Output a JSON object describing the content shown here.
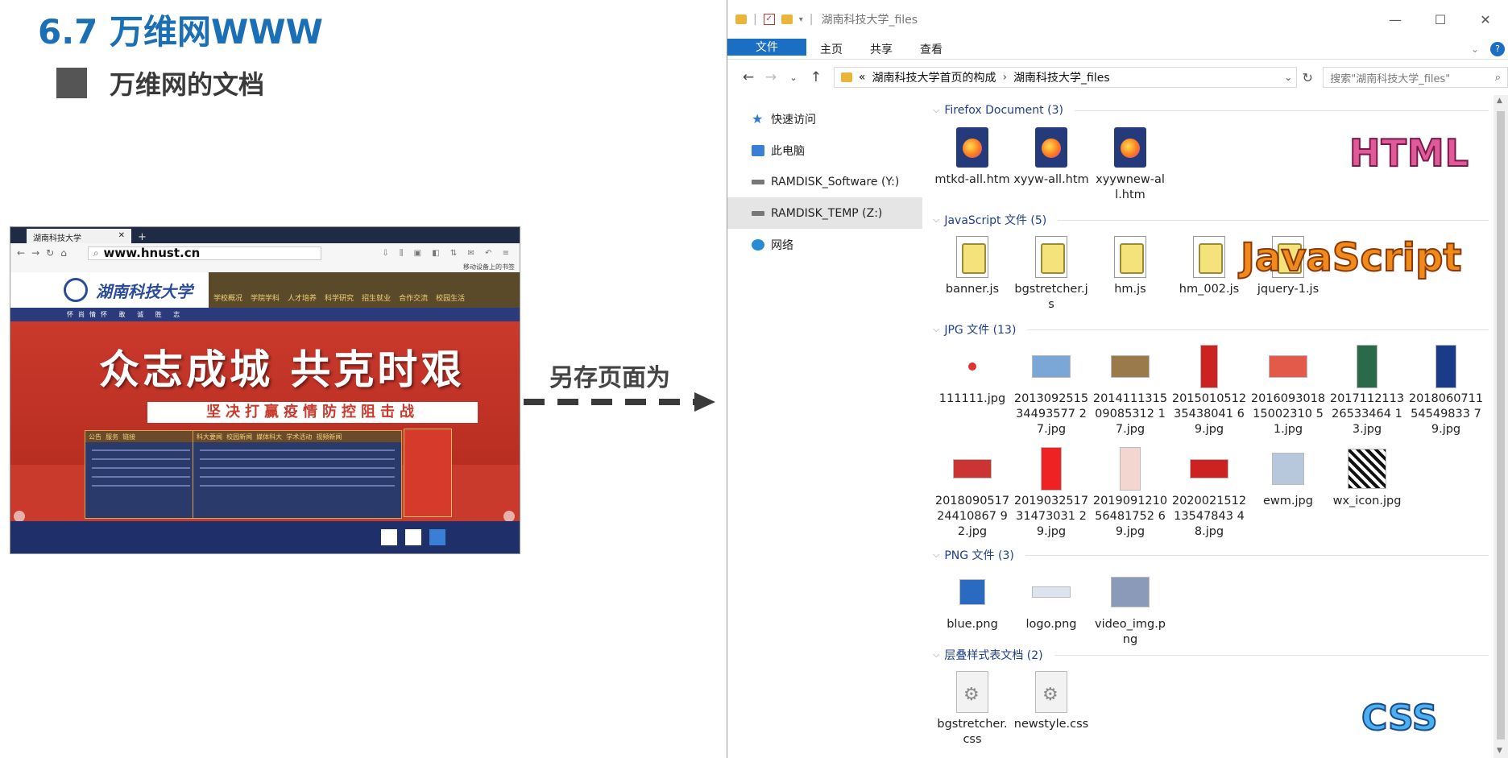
{
  "slide": {
    "title": "6.7 万维网WWW",
    "subtitle": "万维网的文档"
  },
  "browser": {
    "tab_title": "湖南科技大学",
    "url": "www.hnust.cn",
    "bookmark_hint": "移动设备上的书签",
    "logo_text": "湖南科技大学",
    "nav_items": [
      "学校概况",
      "学院学科",
      "人才培养",
      "科学研究",
      "招生就业",
      "合作交流",
      "校园生活"
    ],
    "motto": "怀尚情怀 敢 诚 胜 志",
    "banner_title": "众志成城 共克时艰",
    "banner_subtitle": "坚决打赢疫情防控阻击战",
    "panel_a_tabs": [
      "公告",
      "服务",
      "链接"
    ],
    "panel_b_tabs": [
      "科大要闻",
      "校园新闻",
      "媒体科大",
      "学术活动",
      "视频新闻"
    ]
  },
  "saveas_label": "另存页面为",
  "explorer": {
    "title": "湖南科技大学_files",
    "ribbon_tabs": [
      "文件",
      "主页",
      "共享",
      "查看"
    ],
    "breadcrumb": [
      "湖南科技大学首页的构成",
      "湖南科技大学_files"
    ],
    "breadcrumb_prefix": "«",
    "search_placeholder": "搜索\"湖南科技大学_files\"",
    "sidebar": [
      {
        "label": "快速访问",
        "icon": "quick-access-icon"
      },
      {
        "label": "此电脑",
        "icon": "this-pc-icon"
      },
      {
        "label": "RAMDISK_Software (Y:)",
        "icon": "drive-icon"
      },
      {
        "label": "RAMDISK_TEMP (Z:)",
        "icon": "drive-icon"
      },
      {
        "label": "网络",
        "icon": "network-icon"
      }
    ],
    "groups": [
      {
        "header": "Firefox Document (3)",
        "kind": "firefox",
        "files": [
          "mtkd-all.htm",
          "xyyw-all.htm",
          "xyywnew-all.htm"
        ]
      },
      {
        "header": "JavaScript 文件 (5)",
        "kind": "js",
        "files": [
          "banner.js",
          "bgstretcher.js",
          "hm.js",
          "hm_002.js",
          "jquery-1.js"
        ]
      },
      {
        "header": "JPG 文件 (13)",
        "kind": "jpg",
        "files": [
          "111111.jpg",
          "201309251534493577 27.jpg",
          "201411131509085312 17.jpg",
          "201501051235438041 69.jpg",
          "201609301815002310 51.jpg",
          "201711211326533464 13.jpg",
          "201806071154549833 79.jpg",
          "201809051724410867 92.jpg",
          "201903251731473031 29.jpg",
          "201909121056481752 69.jpg",
          "202002151213547843 48.jpg",
          "ewm.jpg",
          "wx_icon.jpg"
        ]
      },
      {
        "header": "PNG 文件 (3)",
        "kind": "png",
        "files": [
          "blue.png",
          "logo.png",
          "video_img.png"
        ]
      },
      {
        "header": "层叠样式表文档 (2)",
        "kind": "css",
        "files": [
          "bgstretcher.css",
          "newstyle.css"
        ]
      }
    ]
  },
  "overlays": {
    "html": "HTML",
    "javascript": "JavaScript",
    "css": "CSS"
  },
  "colors": {
    "title_blue": "#1a6fb5",
    "ribbon_file": "#1a6fc5",
    "group_header": "#1e3f8a"
  }
}
